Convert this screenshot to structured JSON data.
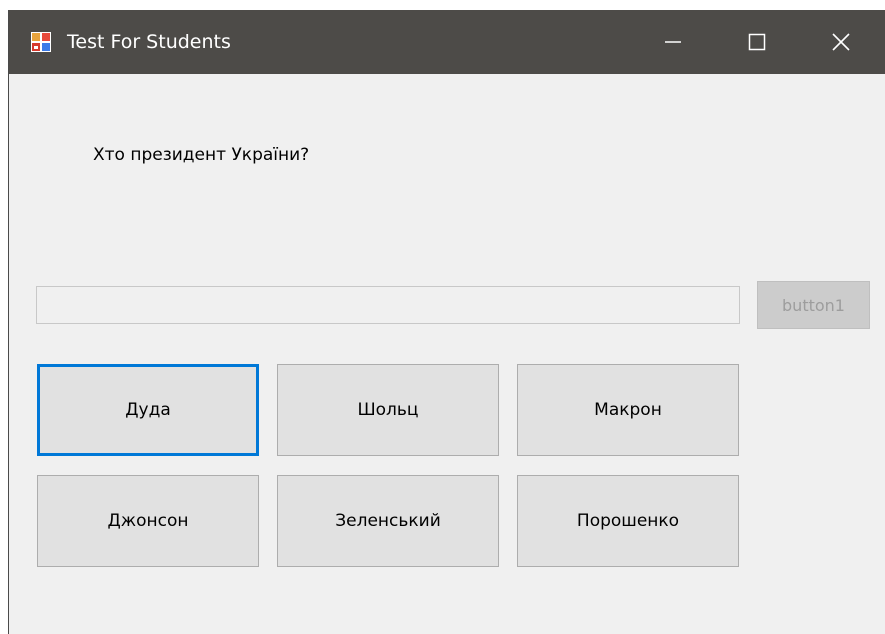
{
  "window": {
    "title": "Test For Students",
    "icon": "form-app-icon"
  },
  "controls": {
    "minimize": "minimize-icon",
    "maximize": "maximize-icon",
    "close": "close-icon"
  },
  "question": {
    "text": "Хто президент України?"
  },
  "answer_field": {
    "value": ""
  },
  "submit_button": {
    "label": "button1",
    "enabled": false
  },
  "options": [
    {
      "label": "Дуда",
      "focused": true
    },
    {
      "label": "Шольц",
      "focused": false
    },
    {
      "label": "Макрон",
      "focused": false
    },
    {
      "label": "Джонсон",
      "focused": false
    },
    {
      "label": "Зеленський",
      "focused": false
    },
    {
      "label": "Порошенко",
      "focused": false
    }
  ],
  "colors": {
    "titlebar": "#4d4b48",
    "window_bg": "#f0f0f0",
    "focus_border": "#0078d7",
    "button_bg": "#e1e1e1",
    "disabled_text": "#9d9d9d"
  }
}
